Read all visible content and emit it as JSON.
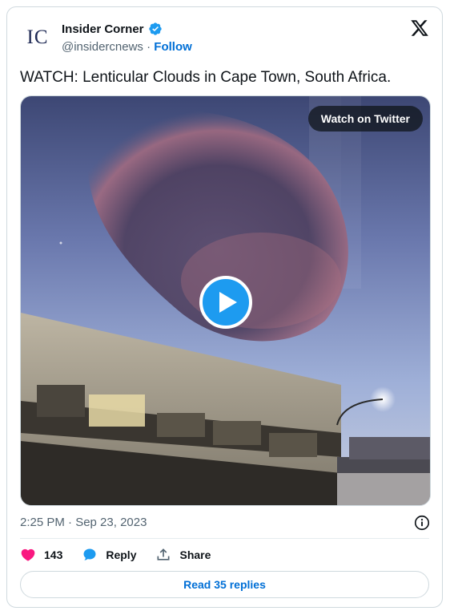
{
  "author": {
    "avatar_text": "IC",
    "name": "Insider Corner",
    "handle": "@insidercnews",
    "separator": "·",
    "follow_label": "Follow"
  },
  "tweet": {
    "text": "WATCH: Lenticular Clouds in Cape Town, South Africa.",
    "timestamp": "2:25 PM · Sep 23, 2023"
  },
  "media": {
    "watch_label": "Watch on Twitter"
  },
  "actions": {
    "like_count": "143",
    "reply_label": "Reply",
    "share_label": "Share"
  },
  "footer": {
    "read_replies_label": "Read 35 replies"
  },
  "colors": {
    "accent": "#1d9bf0",
    "like": "#f91880",
    "link": "#006fd6"
  }
}
